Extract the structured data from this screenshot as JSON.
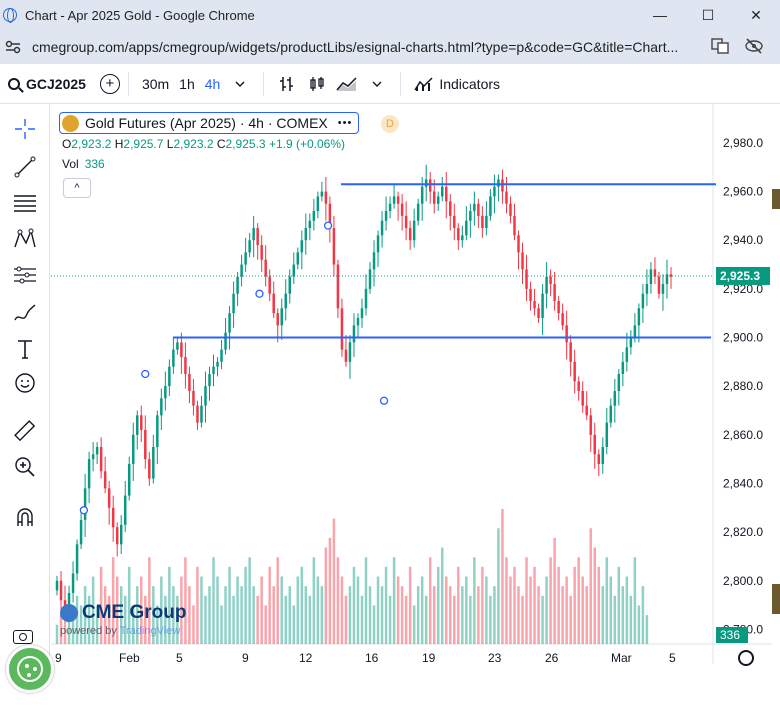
{
  "window": {
    "title": "Chart - Apr 2025 Gold - Google Chrome",
    "minimize_glyph": "—",
    "maximize_glyph": "☐",
    "close_glyph": "✕"
  },
  "address_bar": {
    "url": "cmegroup.com/apps/cmegroup/widgets/productLibs/esignal-charts.html?type=p&code=GC&title=Chart...",
    "site_icon": "tune-icon",
    "right_icons": [
      "translate-icon",
      "eye-off-icon"
    ]
  },
  "toolbar": {
    "symbol": "GCJ2025",
    "timeframes": [
      "30m",
      "1h",
      "4h"
    ],
    "active_timeframe": "4h",
    "indicators_label": "Indicators"
  },
  "left_tools": [
    "crosshair-icon",
    "trend-line-icon",
    "fib-icon",
    "pattern-icon",
    "prediction-icon",
    "brush-icon",
    "text-icon",
    "emoji-icon",
    "ruler-icon",
    "zoom-in-icon",
    "magnet-icon",
    "camera-icon"
  ],
  "legend": {
    "title": "Gold Futures (Apr 2025) · 4h · COMEX",
    "dots": "•••",
    "badge": "D",
    "open_label": "O",
    "open": "2,923.2",
    "high_label": "H",
    "high": "2,925.7",
    "low_label": "L",
    "low": "2,923.2",
    "close_label": "C",
    "close": "2,925.3",
    "change": "+1.9 (+0.06%)",
    "vol_label": "Vol",
    "vol": "336",
    "collapse_glyph": "^"
  },
  "branding": {
    "logo_text": "CME Group",
    "powered_by": "powered by",
    "tradingview": "TradingView"
  },
  "colors": {
    "up": "#089981",
    "down": "#f23645",
    "line": "#2962ff",
    "price_tag": "#089981"
  },
  "chart_data": {
    "type": "candlestick",
    "y_ticks": [
      "2,980.0",
      "2,960.0",
      "2,940.0",
      "2,920.0",
      "2,900.0",
      "2,880.0",
      "2,860.0",
      "2,840.0",
      "2,820.0",
      "2,800.0",
      "2,780.0"
    ],
    "y_tick_values": [
      2980,
      2960,
      2940,
      2920,
      2900,
      2880,
      2860,
      2840,
      2820,
      2800,
      2780
    ],
    "ylim": [
      2774,
      2996
    ],
    "x_ticks": [
      "9",
      "Feb",
      "5",
      "9",
      "12",
      "16",
      "19",
      "23",
      "26",
      "Mar",
      "5"
    ],
    "last_price_label": "2,925.3",
    "last_price": 2925.3,
    "volume_label": "336",
    "horizontal_lines": [
      {
        "y_start": 2963.0,
        "y_end": 2963.0
      },
      {
        "y_start": 2900.0,
        "y_end": 2900.0
      }
    ],
    "closes": [
      2800,
      2792,
      2788,
      2795,
      2803,
      2815,
      2825,
      2838,
      2850,
      2852,
      2855,
      2845,
      2838,
      2830,
      2822,
      2815,
      2823,
      2835,
      2848,
      2860,
      2868,
      2862,
      2850,
      2842,
      2855,
      2868,
      2875,
      2880,
      2888,
      2895,
      2898,
      2892,
      2885,
      2878,
      2872,
      2865,
      2872,
      2880,
      2885,
      2888,
      2890,
      2895,
      2902,
      2910,
      2918,
      2925,
      2930,
      2935,
      2940,
      2945,
      2938,
      2932,
      2925,
      2918,
      2910,
      2905,
      2912,
      2918,
      2925,
      2930,
      2935,
      2940,
      2945,
      2948,
      2952,
      2958,
      2960,
      2955,
      2945,
      2930,
      2912,
      2895,
      2890,
      2898,
      2905,
      2908,
      2912,
      2920,
      2928,
      2935,
      2942,
      2948,
      2952,
      2955,
      2958,
      2955,
      2950,
      2945,
      2940,
      2948,
      2955,
      2962,
      2965,
      2960,
      2955,
      2958,
      2962,
      2956,
      2950,
      2945,
      2940,
      2942,
      2948,
      2952,
      2955,
      2950,
      2945,
      2950,
      2958,
      2962,
      2965,
      2960,
      2955,
      2950,
      2942,
      2935,
      2928,
      2920,
      2915,
      2912,
      2908,
      2918,
      2925,
      2922,
      2915,
      2910,
      2905,
      2898,
      2890,
      2882,
      2878,
      2872,
      2868,
      2860,
      2852,
      2848,
      2855,
      2865,
      2872,
      2878,
      2885,
      2890,
      2896,
      2900,
      2905,
      2912,
      2918,
      2922,
      2928,
      2925,
      2918,
      2922,
      2926,
      2925
    ],
    "volumes": [
      2,
      3,
      2,
      4,
      3,
      5,
      4,
      6,
      5,
      7,
      4,
      8,
      6,
      5,
      9,
      7,
      6,
      5,
      8,
      4,
      6,
      7,
      5,
      9,
      6,
      4,
      7,
      5,
      8,
      6,
      5,
      7,
      9,
      6,
      4,
      8,
      7,
      5,
      6,
      9,
      7,
      4,
      6,
      8,
      5,
      7,
      6,
      8,
      9,
      6,
      5,
      7,
      4,
      8,
      6,
      9,
      7,
      5,
      6,
      4,
      7,
      8,
      6,
      5,
      9,
      7,
      6,
      10,
      11,
      13,
      9,
      7,
      5,
      6,
      8,
      7,
      5,
      9,
      6,
      4,
      7,
      6,
      8,
      5,
      9,
      7,
      6,
      5,
      8,
      4,
      6,
      7,
      5,
      9,
      6,
      8,
      10,
      7,
      6,
      5,
      8,
      6,
      7,
      5,
      9,
      6,
      8,
      7,
      5,
      6,
      12,
      14,
      9,
      7,
      8,
      6,
      5,
      9,
      7,
      8,
      6,
      5,
      7,
      9,
      11,
      8,
      6,
      7,
      5,
      8,
      9,
      7,
      6,
      12,
      10,
      8,
      6,
      9,
      7,
      5,
      8,
      6,
      7,
      5,
      9,
      4,
      6,
      3
    ]
  }
}
